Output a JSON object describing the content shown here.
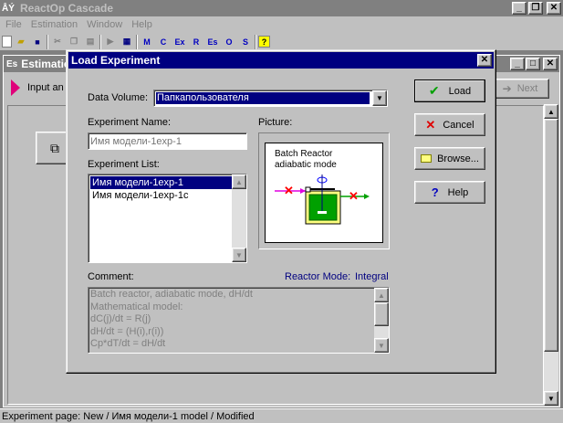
{
  "app": {
    "title": "ReactOp Cascade",
    "icon_text": "ÅÝ"
  },
  "menu": [
    "File",
    "Estimation",
    "Window",
    "Help"
  ],
  "toolbar_letters": [
    "M",
    "C",
    "Ex",
    "R",
    "Es",
    "O",
    "S"
  ],
  "child": {
    "icon_text": "Es",
    "title": "Estimatio",
    "input_label": "Input an",
    "next_label": "Next"
  },
  "dialog": {
    "title": "Load Experiment",
    "data_volume_label": "Data Volume:",
    "data_volume_value": "Папкапользователя",
    "experiment_name_label": "Experiment Name:",
    "experiment_name_placeholder": "Имя модели-1exp-1",
    "experiment_list_label": "Experiment List:",
    "experiment_list": [
      "Имя модели-1exp-1",
      "Имя модели-1exp-1c"
    ],
    "selected_index": 0,
    "picture_label": "Picture:",
    "picture_title_1": "Batch Reactor",
    "picture_title_2": "adiabatic mode",
    "comment_label": "Comment:",
    "reactor_mode_label": "Reactor Mode:",
    "reactor_mode_value": "Integral",
    "comment_lines": [
      "Batch reactor, adiabatic mode, dH/dt",
      "Mathematical model:",
      "dC(j)/dt = R(j)",
      "dH/dt = (H(i),r(i))",
      "Cp*dT/dt = dH/dt"
    ],
    "buttons": {
      "load": "Load",
      "cancel": "Cancel",
      "browse": "Browse...",
      "help": "Help"
    }
  },
  "status": "Experiment page:  New / Имя модели-1 model / Modified",
  "colors": {
    "titlebar_active": "#000080",
    "titlebar_inactive": "#808080",
    "face": "#c0c0c0",
    "selection": "#000080",
    "reactor_green": "#00a000",
    "reactor_yellow": "#ffff80"
  }
}
